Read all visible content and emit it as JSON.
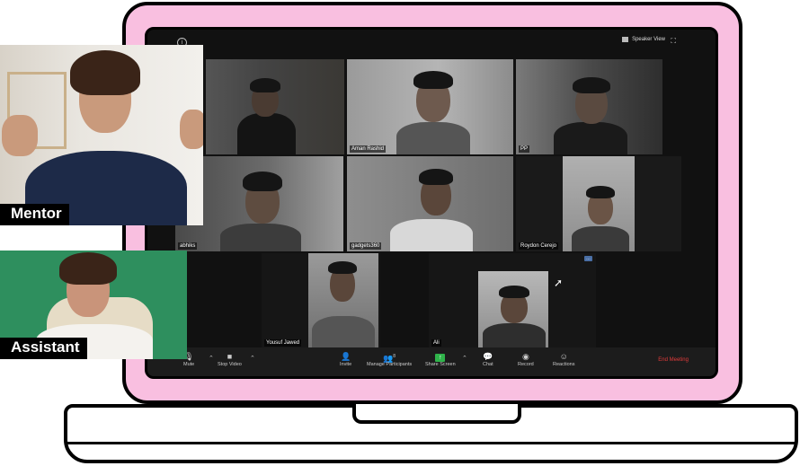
{
  "toolbar_top": {
    "view_label": "Speaker View"
  },
  "participants": [
    {
      "name": ""
    },
    {
      "name": "Aman Rashid"
    },
    {
      "name": "PP"
    },
    {
      "name": "abhiks"
    },
    {
      "name": "gadgets360"
    },
    {
      "name": "Roydon Cerejo"
    },
    {
      "name": "Yousuf Jawed"
    },
    {
      "name": "Ali"
    }
  ],
  "toolbar": {
    "mute": "Mute",
    "stop_video": "Stop Video",
    "invite": "Invite",
    "manage_participants": "Manage Participants",
    "participants_count": "8",
    "share_screen": "Share Screen",
    "chat": "Chat",
    "record": "Record",
    "reactions": "Reactions",
    "end_meeting": "End Meeting"
  },
  "overlays": {
    "mentor_label": "Mentor",
    "assistant_label": "Assistant"
  },
  "colors": {
    "laptop_pink": "#f9bfe0",
    "end_red": "#e23b3b",
    "share_green": "#2fb34a"
  },
  "icons": [
    "info-icon",
    "speaker-view-icon",
    "fullscreen-icon",
    "microphone-icon",
    "camera-icon",
    "invite-icon",
    "participants-icon",
    "share-screen-icon",
    "chat-icon",
    "record-icon",
    "reactions-icon",
    "cursor-icon"
  ]
}
